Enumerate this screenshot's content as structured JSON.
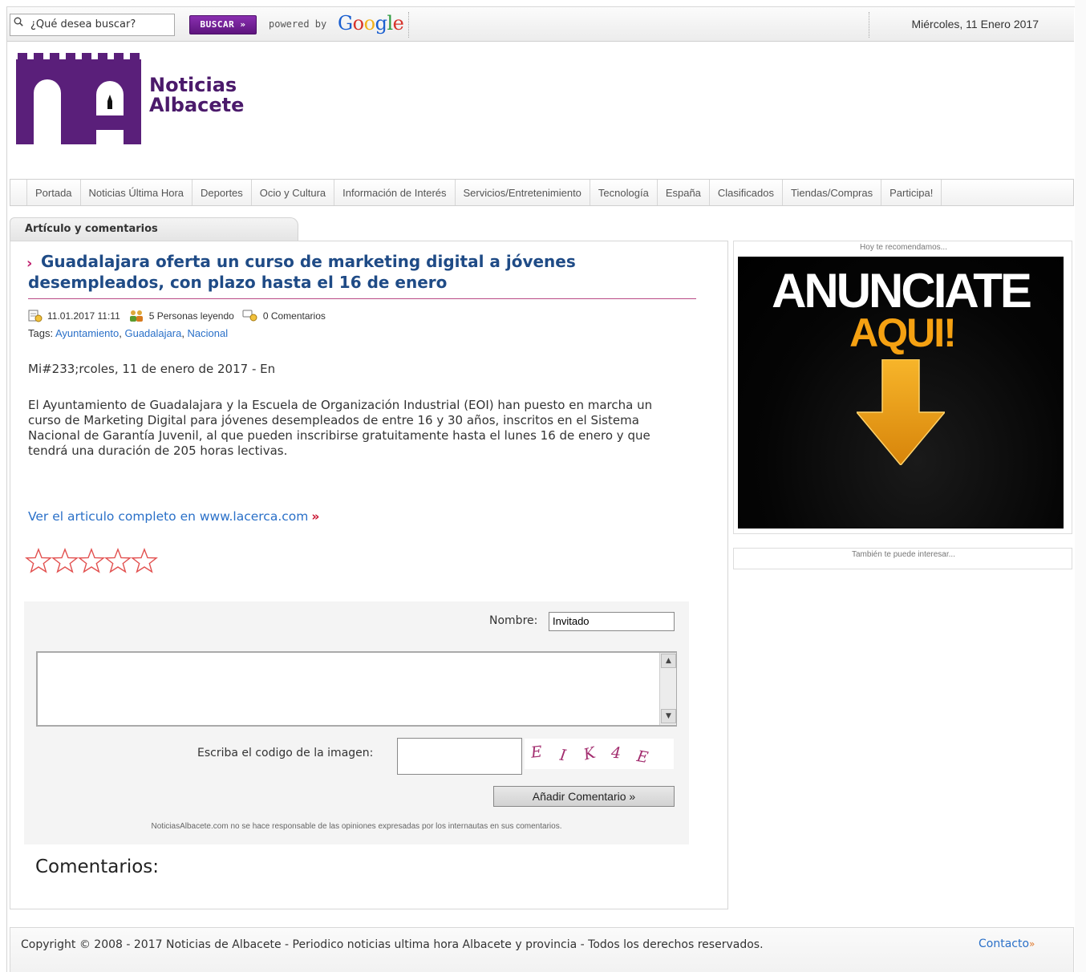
{
  "topbar": {
    "search_placeholder": "¿Qué desea buscar?",
    "search_button": "BUSCAR »",
    "powered_by": "powered by",
    "google": [
      "G",
      "o",
      "o",
      "g",
      "l",
      "e"
    ],
    "google_colors": [
      "#1a5fd0",
      "#d7332b",
      "#f2b21c",
      "#1a5fd0",
      "#2e9a3f",
      "#d7332b"
    ],
    "date": "Miércoles, 11 Enero 2017"
  },
  "logo": {
    "line1": "Noticias",
    "line2": "Albacete",
    "color": "#5a1f7a"
  },
  "nav": [
    "Portada",
    "Noticias Última Hora",
    "Deportes",
    "Ocio y Cultura",
    "Información de Interés",
    "Servicios/Entretenimiento",
    "Tecnología",
    "España",
    "Clasificados",
    "Tiendas/Compras",
    "Participa!"
  ],
  "main": {
    "tab_label": "Artículo y comentarios",
    "title": "Guadalajara oferta un curso de marketing digital a jóvenes desempleados, con plazo hasta el 16 de enero",
    "meta": {
      "datetime": "11.01.2017 11:11",
      "readers": "5 Personas leyendo",
      "comments": "0 Comentarios"
    },
    "tags_label": "Tags:",
    "tags": [
      "Ayuntamiento",
      "Guadalajara",
      "Nacional"
    ],
    "date_line": "Mi#233;rcoles, 11 de enero de 2017 - En",
    "body": "El Ayuntamiento de Guadalajara y la Escuela de Organización Industrial (EOI) han puesto en marcha un curso de Marketing Digital para jóvenes desempleados de entre 16 y 30 años, inscritos en el Sistema Nacional de Garantía Juvenil, al que pueden inscribirse gratuitamente hasta el lunes 16 de enero y que tendrá una duración de 205 horas lectivas.",
    "full_link": "Ver el articulo completo en www.lacerca.com",
    "full_link_arrow": "»",
    "rating": {
      "filled": 0,
      "max": 5
    }
  },
  "form": {
    "name_label": "Nombre:",
    "name_value": "Invitado",
    "captcha_label": "Escriba el codigo de la imagen:",
    "captcha_chars": [
      "E",
      "I",
      "K",
      "4",
      "E"
    ],
    "submit": "Añadir Comentario »",
    "disclaimer": "NoticiasAlbacete.com no se hace responsable de las opiniones expresadas por los internautas en sus comentarios.",
    "comments_heading": "Comentarios:"
  },
  "sidebar": {
    "recommend_label": "Hoy te recomendamos...",
    "ad_line1": "ANUNCIATE",
    "ad_line2": "AQUI!",
    "interest_label": "También te puede interesar..."
  },
  "footer": {
    "copyright": "Copyright © 2008 - 2017 Noticias de Albacete - Periodico noticias ultima hora Albacete y provincia  - Todos los derechos reservados.",
    "contact": "Contacto",
    "contact_arrow": "»"
  },
  "colors": {
    "accent_purple": "#5a1f7a",
    "link_blue": "#2a70c8",
    "title_blue": "#1f4b86",
    "ad_orange": "#f5a112"
  }
}
